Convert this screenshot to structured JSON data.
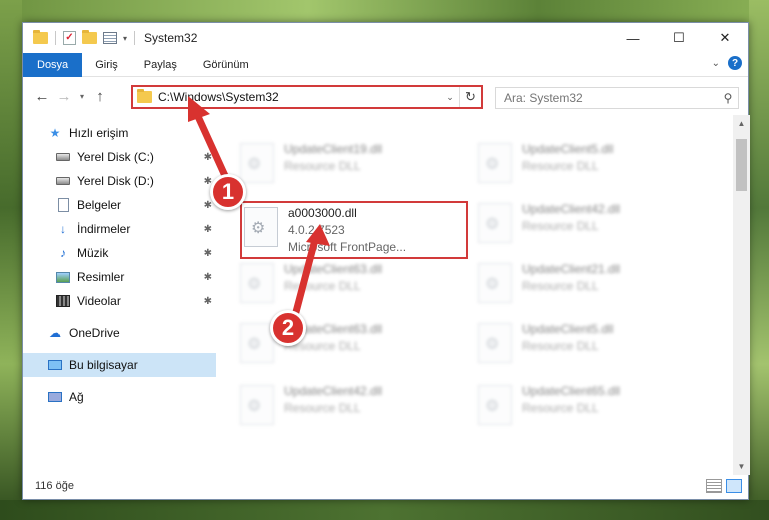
{
  "window": {
    "title": "System32",
    "minimize_glyph": "—",
    "maximize_glyph": "☐",
    "close_glyph": "✕"
  },
  "ribbon": {
    "tabs": [
      "Dosya",
      "Giriş",
      "Paylaş",
      "Görünüm"
    ],
    "help_glyph": "?"
  },
  "address": {
    "path": "C:\\Windows\\System32",
    "search_placeholder": "Ara: System32"
  },
  "sidebar": {
    "quick_access": "Hızlı erişim",
    "items": [
      {
        "label": "Yerel Disk (C:)",
        "icon": "drive-icon"
      },
      {
        "label": "Yerel Disk (D:)",
        "icon": "drive-icon"
      },
      {
        "label": "Belgeler",
        "icon": "documents-icon"
      },
      {
        "label": "İndirmeler",
        "icon": "downloads-icon"
      },
      {
        "label": "Müzik",
        "icon": "music-icon"
      },
      {
        "label": "Resimler",
        "icon": "pictures-icon"
      },
      {
        "label": "Videolar",
        "icon": "videos-icon"
      }
    ],
    "onedrive": "OneDrive",
    "this_pc": "Bu bilgisayar",
    "network": "Ağ"
  },
  "files": {
    "highlighted": {
      "name": "a0003000.dll",
      "version": "4.0.2.7523",
      "description": "Microsoft FrontPage..."
    },
    "background": [
      {
        "name": "UpdateClient19.dll",
        "sub": "Resource DLL"
      },
      {
        "name": "UpdateClient5.dll",
        "sub": "Resource DLL"
      },
      {
        "name": "UpdateClient42.dll",
        "sub": "Resource DLL"
      },
      {
        "name": "UpdateClient63.dll",
        "sub": "Resource DLL"
      },
      {
        "name": "UpdateClient21.dll",
        "sub": "Resource DLL"
      },
      {
        "name": "UpdateClient63.dll",
        "sub": "Resource DLL"
      },
      {
        "name": "UpdateClient5.dll",
        "sub": "Resource DLL"
      },
      {
        "name": "UpdateClient42.dll",
        "sub": "Resource DLL"
      },
      {
        "name": "UpdateClient65.dll",
        "sub": "Resource DLL"
      }
    ]
  },
  "status": {
    "count": "116 öğe"
  },
  "callouts": {
    "one": "1",
    "two": "2"
  },
  "colors": {
    "accent": "#1a6fc9",
    "highlight_red": "#d23a3a",
    "selection": "#cce4f7"
  }
}
